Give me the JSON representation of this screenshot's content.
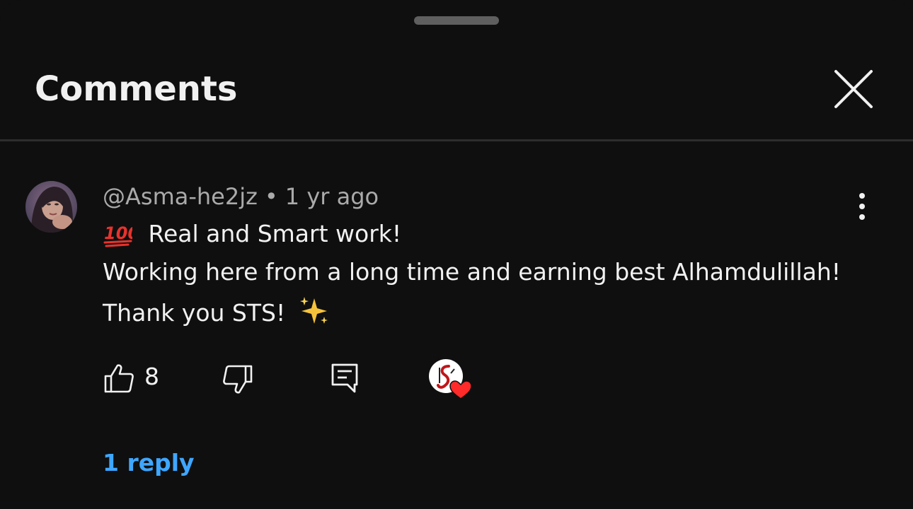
{
  "header": {
    "title": "Comments"
  },
  "comment": {
    "author": "@Asma-he2jz",
    "separator": "•",
    "timestamp": "1 yr ago",
    "lines": [
      "Real and Smart work!",
      "Working here from a long time and earning best Alhamdulillah!",
      "Thank you STS!"
    ],
    "emojis": {
      "line1_prefix": "hundred-points-emoji",
      "line3_suffix": "sparkles-emoji"
    },
    "like_count": "8",
    "replies_label": "1 reply"
  },
  "icons": {
    "close": "close-icon",
    "more": "more-vert-icon",
    "like": "thumbs-up-icon",
    "dislike": "thumbs-down-icon",
    "reply": "comment-reply-icon",
    "creator_heart": "creator-heart-icon"
  },
  "colors": {
    "background": "#0f0f0f",
    "text": "#f1f1f1",
    "secondary_text": "#aaaaaa",
    "link": "#3ea6ff",
    "heart": "#ff2b2b"
  }
}
